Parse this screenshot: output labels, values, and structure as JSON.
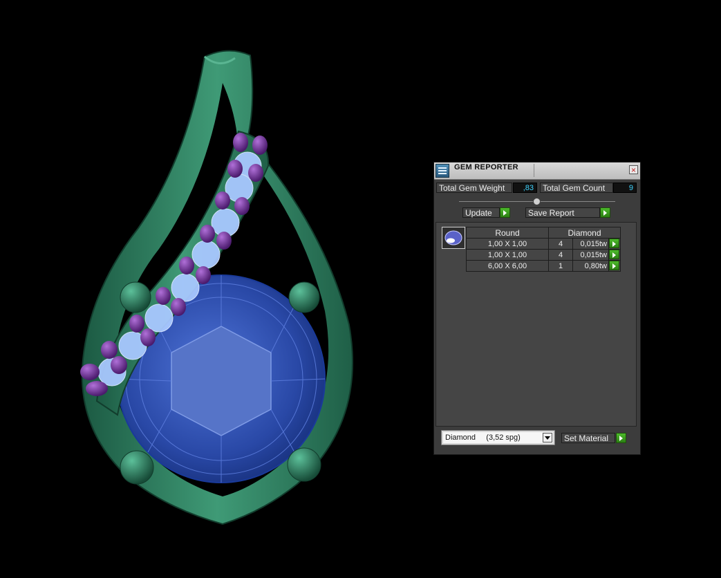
{
  "panel": {
    "title": "GEM REPORTER",
    "close_symbol": "×",
    "total_weight_label": "Total Gem Weight",
    "total_weight_value": ",83",
    "total_count_label": "Total Gem Count",
    "total_count_value": "9",
    "update_label": "Update",
    "save_report_label": "Save Report",
    "table": {
      "header_shape": "Round",
      "header_material": "Diamond",
      "rows": [
        {
          "size": "1,00 X 1,00",
          "count": "4",
          "weight": "0,015tw"
        },
        {
          "size": "1,00 X 1,00",
          "count": "4",
          "weight": "0,015tw"
        },
        {
          "size": "6,00 X 6,00",
          "count": "1",
          "weight": "0,80tw"
        }
      ]
    },
    "material_select": "Diamond     (3,52 spg)",
    "set_material_label": "Set Material"
  },
  "icons": {
    "title": "gem-report-icon",
    "thumb": "round-gem-icon",
    "arrow": "play-arrow-icon",
    "dropdown": "chevron-down-icon"
  },
  "colors": {
    "metal": "#2c7a5e",
    "center_stone": "#2d4fb0",
    "side_stones": "#a8c8ff",
    "prongs": "#7a3aa2",
    "accent_green": "#3ea820",
    "value_text": "#3fd4ff"
  }
}
